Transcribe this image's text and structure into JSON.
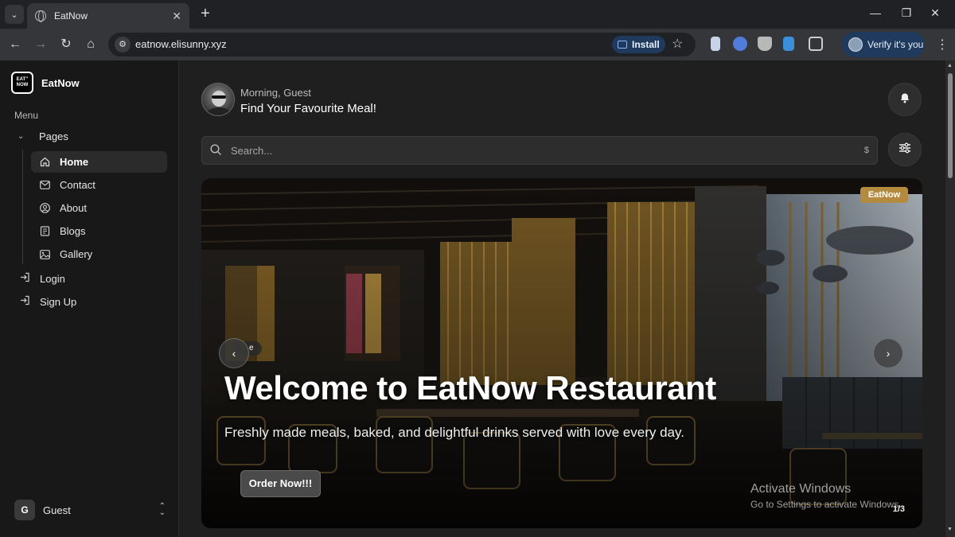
{
  "browser": {
    "tab_title": "EatNow",
    "new_tab": "+",
    "url": "eatnow.elisunny.xyz",
    "install_label": "Install",
    "profile_label": "Verify it's you"
  },
  "sidebar": {
    "brand_logo_text": "EAT’’ NOW",
    "brand_name": "EatNow",
    "menu_label": "Menu",
    "pages_label": "Pages",
    "items": [
      {
        "label": "Home",
        "icon": "home-icon",
        "active": true
      },
      {
        "label": "Contact",
        "icon": "mail-icon"
      },
      {
        "label": "About",
        "icon": "user-circle-icon"
      },
      {
        "label": "Blogs",
        "icon": "blog-icon"
      },
      {
        "label": "Gallery",
        "icon": "image-icon"
      }
    ],
    "auth": [
      {
        "label": "Login",
        "icon": "login-icon"
      },
      {
        "label": "Sign Up",
        "icon": "signup-icon"
      }
    ],
    "user": {
      "initial": "G",
      "name": "Guest"
    }
  },
  "header": {
    "greeting": "Morning, Guest",
    "headline": "Find Your Favourite Meal!"
  },
  "search": {
    "placeholder": "Search...",
    "suffix": "$"
  },
  "hero": {
    "badge": "EatNow",
    "chip": "e",
    "title": "Welcome to EatNow Restaurant",
    "subtitle": "Freshly made meals, baked, and delightful drinks served with love every day.",
    "cta": "Order Now!!!",
    "counter": "1/3"
  },
  "watermark": {
    "line1": "Activate Windows",
    "line2": "Go to Settings to activate Windows."
  }
}
